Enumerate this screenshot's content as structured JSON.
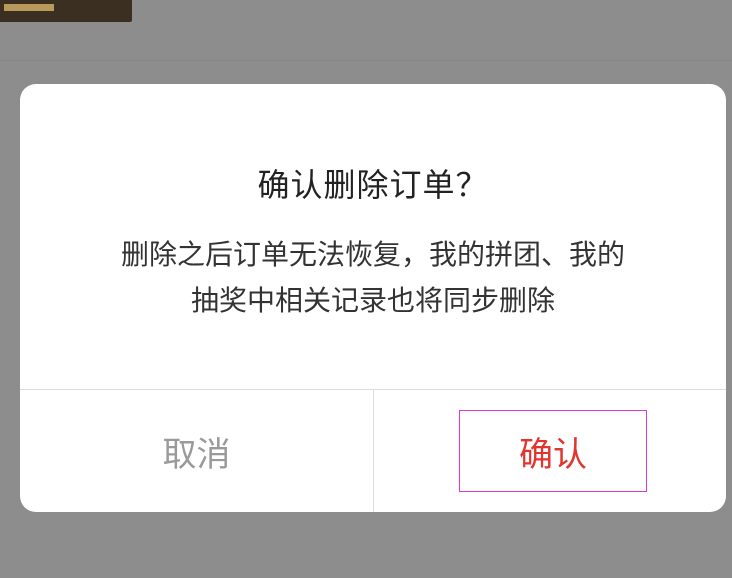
{
  "dialog": {
    "title": "确认删除订单？",
    "message_line1": "删除之后订单无法恢复，我的拼团、我的",
    "message_line2": "抽奖中相关记录也将同步删除",
    "cancel_label": "取消",
    "confirm_label": "确认"
  },
  "colors": {
    "overlay": "#8d8d8d",
    "confirm_text": "#e0362f",
    "cancel_text": "#9a9a9a",
    "highlight_border": "#d63bd6"
  }
}
